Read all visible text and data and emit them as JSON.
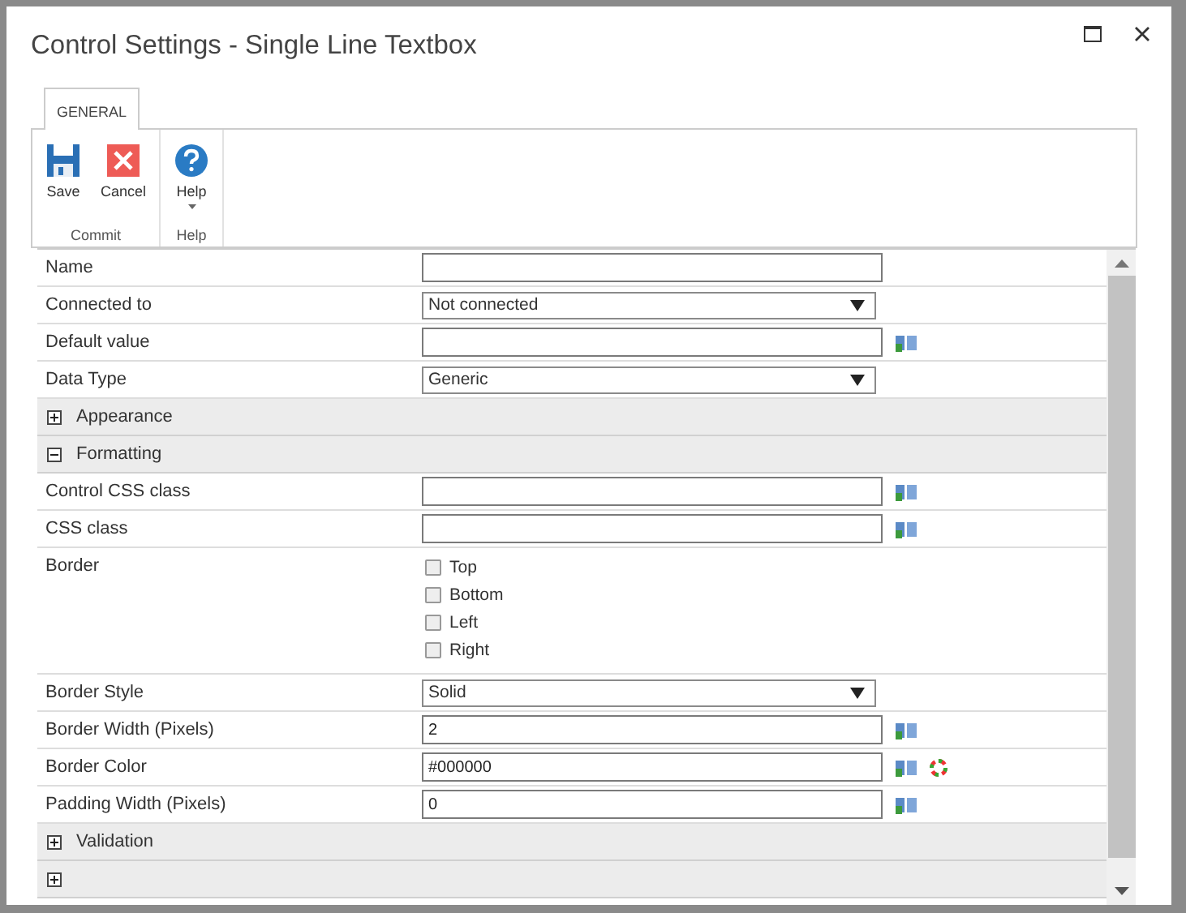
{
  "window": {
    "title": "Control Settings - Single Line Textbox"
  },
  "tabs": [
    {
      "label": "GENERAL",
      "selected": true
    }
  ],
  "ribbon": {
    "groups": [
      {
        "label": "Commit",
        "buttons": [
          {
            "label": "Save",
            "kind": "save"
          },
          {
            "label": "Cancel",
            "kind": "cancel"
          }
        ]
      },
      {
        "label": "Help",
        "buttons": [
          {
            "label": "Help",
            "kind": "help",
            "dropdown": true
          }
        ]
      }
    ]
  },
  "rows": [
    {
      "kind": "text",
      "label": "Name",
      "value": "",
      "lookup": false
    },
    {
      "kind": "select",
      "label": "Connected to",
      "value": "Not connected"
    },
    {
      "kind": "text",
      "label": "Default value",
      "value": "",
      "lookup": true
    },
    {
      "kind": "select",
      "label": "Data Type",
      "value": "Generic"
    },
    {
      "kind": "section",
      "label": "Appearance",
      "expanded": false
    },
    {
      "kind": "section",
      "label": "Formatting",
      "expanded": true
    },
    {
      "kind": "text",
      "label": "Control CSS class",
      "value": "",
      "lookup": true
    },
    {
      "kind": "text",
      "label": "CSS class",
      "value": "",
      "lookup": true
    },
    {
      "kind": "checkboxes",
      "label": "Border",
      "options": [
        {
          "label": "Top",
          "checked": false
        },
        {
          "label": "Bottom",
          "checked": false
        },
        {
          "label": "Left",
          "checked": false
        },
        {
          "label": "Right",
          "checked": false
        }
      ]
    },
    {
      "kind": "select",
      "label": "Border Style",
      "value": "Solid"
    },
    {
      "kind": "text",
      "label": "Border Width (Pixels)",
      "value": "2",
      "lookup": true
    },
    {
      "kind": "text",
      "label": "Border Color",
      "value": "#000000",
      "lookup": true,
      "color_picker": true
    },
    {
      "kind": "text",
      "label": "Padding Width (Pixels)",
      "value": "0",
      "lookup": true
    },
    {
      "kind": "section",
      "label": "Validation",
      "expanded": false
    },
    {
      "kind": "section",
      "label": "",
      "expanded": false
    }
  ]
}
